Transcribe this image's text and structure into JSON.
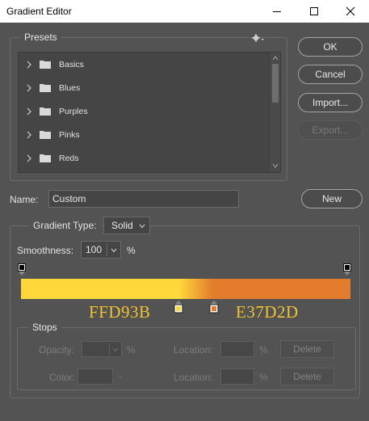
{
  "window": {
    "title": "Gradient Editor",
    "controls": [
      "minimize",
      "maximize",
      "close"
    ]
  },
  "presets": {
    "label": "Presets",
    "items": [
      {
        "label": "Basics"
      },
      {
        "label": "Blues"
      },
      {
        "label": "Purples"
      },
      {
        "label": "Pinks"
      },
      {
        "label": "Reds"
      }
    ]
  },
  "buttons": {
    "ok": "OK",
    "cancel": "Cancel",
    "import": "Import...",
    "export": "Export...",
    "new": "New"
  },
  "name": {
    "label": "Name:",
    "value": "Custom"
  },
  "gradient": {
    "type_label": "Gradient Type:",
    "type_value": "Solid",
    "smoothness_label": "Smoothness:",
    "smoothness_value": "100",
    "smoothness_unit": "%",
    "color_left": "#FFD93B",
    "color_right": "#E37D2D",
    "left_stop_hex": "FFD93B",
    "right_stop_hex": "E37D2D"
  },
  "stops": {
    "label": "Stops",
    "opacity_label": "Opacity:",
    "opacity_unit": "%",
    "location_label_1": "Location:",
    "location_unit_1": "%",
    "delete_1": "Delete",
    "color_label": "Color:",
    "location_label_2": "Location:",
    "location_unit_2": "%",
    "delete_2": "Delete"
  }
}
